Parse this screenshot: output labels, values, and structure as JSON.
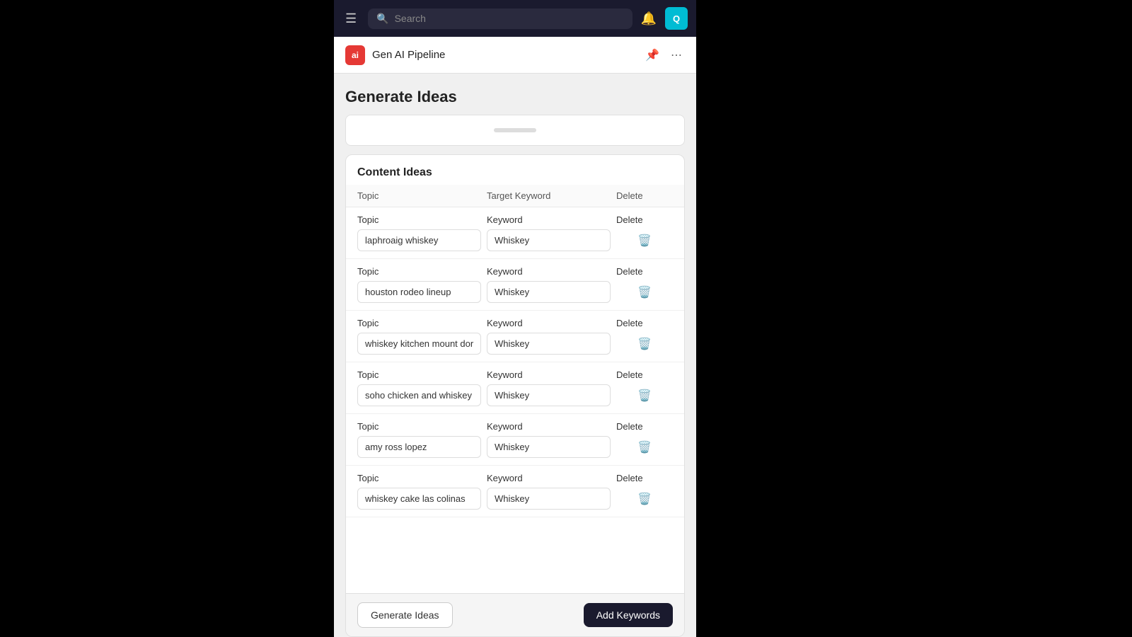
{
  "navbar": {
    "search_placeholder": "Search",
    "avatar_text": "Q"
  },
  "sub_header": {
    "logo_text": "ai",
    "app_title": "Gen AI Pipeline"
  },
  "page": {
    "title": "Generate Ideas"
  },
  "content_ideas": {
    "card_title": "Content Ideas",
    "table_headers": {
      "topic": "Topic",
      "keyword": "Target Keyword",
      "delete": "Delete"
    },
    "rows": [
      {
        "topic_label": "Topic",
        "keyword_label": "Keyword",
        "delete_label": "Delete",
        "topic_value": "laphroaig whiskey",
        "keyword_value": "Whiskey"
      },
      {
        "topic_label": "Topic",
        "keyword_label": "Keyword",
        "delete_label": "Delete",
        "topic_value": "houston rodeo lineup",
        "keyword_value": "Whiskey"
      },
      {
        "topic_label": "Topic",
        "keyword_label": "Keyword",
        "delete_label": "Delete",
        "topic_value": "whiskey kitchen mount dora",
        "keyword_value": "Whiskey"
      },
      {
        "topic_label": "Topic",
        "keyword_label": "Keyword",
        "delete_label": "Delete",
        "topic_value": "soho chicken and whiskey",
        "keyword_value": "Whiskey"
      },
      {
        "topic_label": "Topic",
        "keyword_label": "Keyword",
        "delete_label": "Delete",
        "topic_value": "amy ross lopez",
        "keyword_value": "Whiskey"
      },
      {
        "topic_label": "Topic",
        "keyword_label": "Keyword",
        "delete_label": "Delete",
        "topic_value": "whiskey cake las colinas",
        "keyword_value": "Whiskey"
      }
    ]
  },
  "buttons": {
    "generate_ideas": "Generate Ideas",
    "add_keywords": "Add Keywords"
  }
}
